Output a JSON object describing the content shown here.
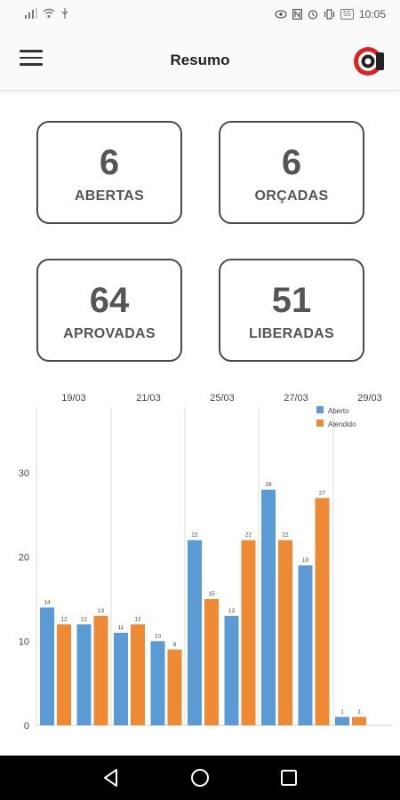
{
  "status_bar": {
    "time": "10:05",
    "battery": "55"
  },
  "header": {
    "title": "Resumo",
    "menu_icon": "hamburger-menu-icon",
    "logo_icon": "brand-logo-icon"
  },
  "cards": [
    {
      "value": "6",
      "label": "ABERTAS"
    },
    {
      "value": "6",
      "label": "ORÇADAS"
    },
    {
      "value": "64",
      "label": "APROVADAS"
    },
    {
      "value": "51",
      "label": "LIBERADAS"
    }
  ],
  "chart_data": {
    "type": "bar",
    "x_tick_labels": [
      "19/03",
      "21/03",
      "25/03",
      "27/03",
      "29/03"
    ],
    "series": [
      {
        "name": "Aberto",
        "color": "#5b9bd5",
        "values": [
          14,
          12,
          11,
          10,
          22,
          13,
          28,
          19,
          1
        ]
      },
      {
        "name": "Atendido",
        "color": "#ef8a34",
        "values": [
          12,
          13,
          12,
          9,
          15,
          22,
          22,
          27,
          1
        ]
      }
    ],
    "y_ticks": [
      0,
      10,
      20,
      30
    ],
    "ylim": [
      0,
      38
    ],
    "legend_position": "top-right",
    "grid": "vertical"
  },
  "nav": {
    "back_icon": "back-triangle-icon",
    "home_icon": "home-circle-icon",
    "recents_icon": "recents-square-icon"
  }
}
